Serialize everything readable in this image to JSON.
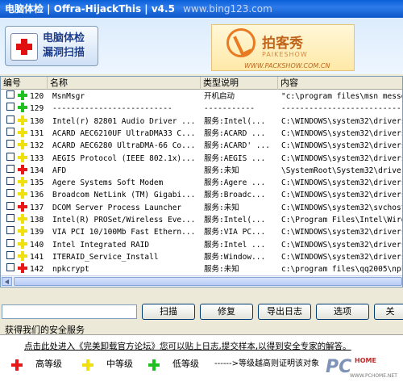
{
  "window": {
    "title": "电脑体检 | Offra-HijackThis | v4.5",
    "watermark": "www.bing123.com"
  },
  "banner": {
    "logo_line1": "电脑体检",
    "logo_line2": "漏洞扫描",
    "ad_name": "拍客秀",
    "ad_sub": "PAIKESHOW",
    "ad_url": "WWW.PACKSHOW.COM.CN"
  },
  "table": {
    "headers": {
      "num": "编号",
      "name": "名称",
      "type": "类型说明",
      "content": "内容"
    },
    "rows": [
      {
        "level": "green",
        "num": "120",
        "name": "MsnMsgr",
        "type": "开机启动",
        "content": "\"c:\\program files\\msn messe"
      },
      {
        "level": "green",
        "num": "129",
        "name": "--------------------------",
        "type": "-----------",
        "content": "---------------------------"
      },
      {
        "level": "yellow",
        "num": "130",
        "name": "Intel(r) 82801 Audio Driver ...",
        "type": "服务:Intel(...",
        "content": "C:\\WINDOWS\\system32\\drivers"
      },
      {
        "level": "yellow",
        "num": "131",
        "name": "ACARD AEC6210UF UltraDMA33 C...",
        "type": "服务:ACARD ...",
        "content": "C:\\WINDOWS\\system32\\drivers"
      },
      {
        "level": "yellow",
        "num": "132",
        "name": "ACARD AEC6280 UltraDMA-66 Co...",
        "type": "服务:ACARD' ...",
        "content": "C:\\WINDOWS\\system32\\drivers"
      },
      {
        "level": "yellow",
        "num": "133",
        "name": "AEGIS Protocol (IEEE 802.1x)...",
        "type": "服务:AEGIS ...",
        "content": "C:\\WINDOWS\\system32\\drivers"
      },
      {
        "level": "red",
        "num": "134",
        "name": "AFD",
        "type": "服务:未知",
        "content": "\\SystemRoot\\System32\\driver"
      },
      {
        "level": "yellow",
        "num": "135",
        "name": "Agere Systems Soft Modem",
        "type": "服务:Agere ...",
        "content": "C:\\WINDOWS\\system32\\drivers"
      },
      {
        "level": "yellow",
        "num": "136",
        "name": "Broadcom NetLink (TM) Gigabi...",
        "type": "服务:Broadc...",
        "content": "C:\\WINDOWS\\system32\\drivers"
      },
      {
        "level": "red",
        "num": "137",
        "name": "DCOM Server Process Launcher",
        "type": "服务:未知",
        "content": "C:\\WINDOWS\\system32\\svchost"
      },
      {
        "level": "yellow",
        "num": "138",
        "name": "Intel(R) PROSet/Wireless Eve...",
        "type": "服务:Intel(...",
        "content": "C:\\Program Files\\Intel\\Wire"
      },
      {
        "level": "yellow",
        "num": "139",
        "name": "VIA PCI 10/100Mb Fast Ethern...",
        "type": "服务:VIA PC...",
        "content": "C:\\WINDOWS\\system32\\drivers"
      },
      {
        "level": "yellow",
        "num": "140",
        "name": "Intel Integrated RAID",
        "type": "服务:Intel ...",
        "content": "C:\\WINDOWS\\system32\\drivers"
      },
      {
        "level": "yellow",
        "num": "141",
        "name": "ITERAID_Service_Install",
        "type": "服务:Window...",
        "content": "C:\\WINDOWS\\system32\\drivers"
      },
      {
        "level": "red",
        "num": "142",
        "name": "npkcrypt",
        "type": "服务:未知",
        "content": "c:\\program files\\qq2005\\npk"
      }
    ]
  },
  "toolbar": {
    "input_value": "",
    "buttons": [
      "扫描",
      "修复",
      "导出日志",
      "选项",
      "关"
    ]
  },
  "services": {
    "title": "获得我们的安全服务",
    "link": "点击此处进入《完美卸载官方论坛》您可以贴上日志,提交样本,以得到安全专家的解答。",
    "legend": [
      {
        "color": "red",
        "label": "高等级"
      },
      {
        "color": "yellow",
        "label": "中等级"
      },
      {
        "color": "green",
        "label": "低等级"
      }
    ],
    "note": "------>等级越高则证明该对象",
    "brand_pc": "PC",
    "brand_home": "HOME",
    "brand_url": "WWW.PCHOME.NET"
  },
  "colors": {
    "red": "#e81818",
    "yellow": "#f0e010",
    "green": "#20c020"
  }
}
